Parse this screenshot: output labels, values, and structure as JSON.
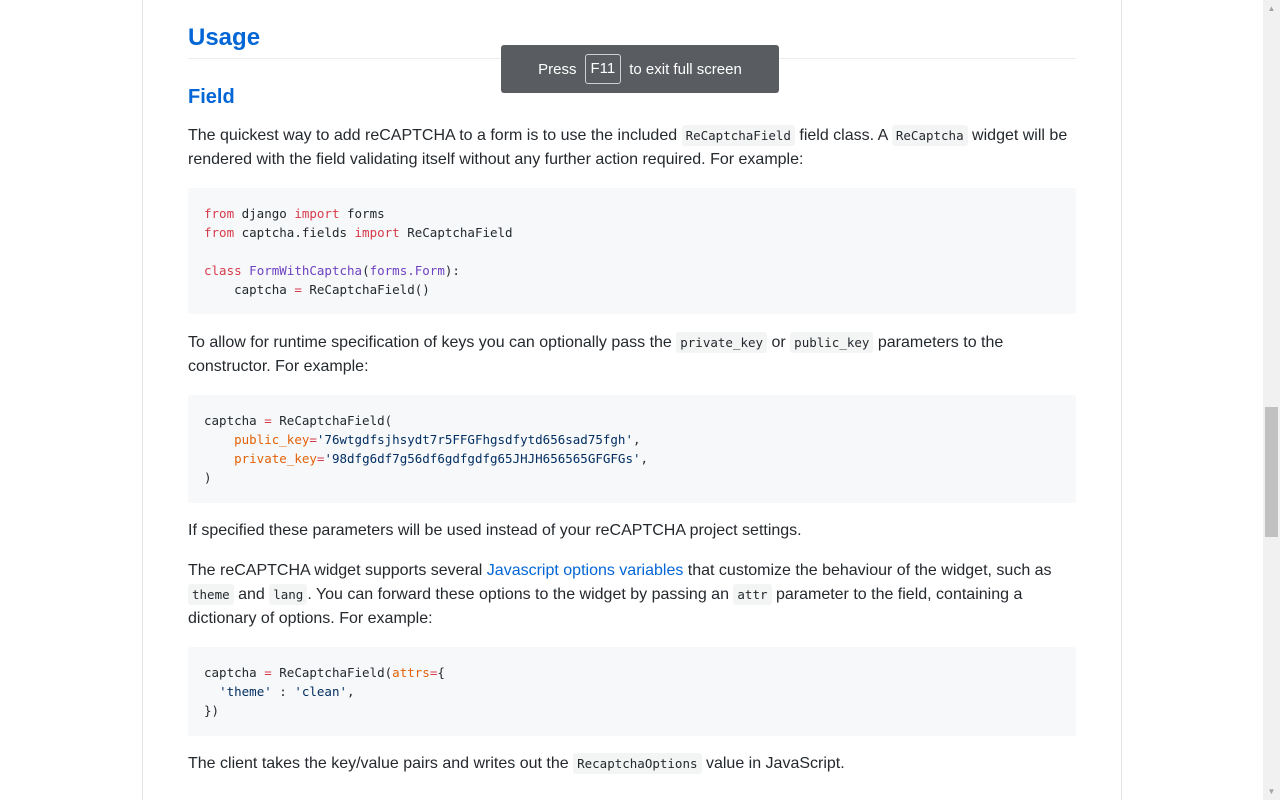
{
  "headings": {
    "usage": "Usage",
    "field": "Field"
  },
  "paragraphs": {
    "p1": {
      "t1": "The quickest way to add reCAPTCHA to a form is to use the included ",
      "c1": "ReCaptchaField",
      "t2": " field class. A ",
      "c2": "ReCaptcha",
      "t3": " widget will be rendered with the field validating itself without any further action required. For example:"
    },
    "p2": {
      "t1": "To allow for runtime specification of keys you can optionally pass the ",
      "c1": "private_key",
      "t2": " or ",
      "c2": "public_key",
      "t3": " parameters to the constructor. For example:"
    },
    "p3": "If specified these parameters will be used instead of your reCAPTCHA project settings.",
    "p4": {
      "t1": "The reCAPTCHA widget supports several ",
      "link": "Javascript options variables",
      "t2": " that customize the behaviour of the widget, such as ",
      "c1": "theme",
      "t3": " and ",
      "c2": "lang",
      "t4": ". You can forward these options to the widget by passing an ",
      "c3": "attr",
      "t5": " parameter to the field, containing a dictionary of options. For example:"
    },
    "p5": {
      "t1": "The client takes the key/value pairs and writes out the ",
      "c1": "RecaptchaOptions",
      "t2": " value in JavaScript."
    }
  },
  "code1": {
    "from": "from",
    "import": "import",
    "django": " django ",
    "forms": " forms",
    "captcha_fields": " captcha.fields ",
    "recaptchafield": " ReCaptchaField",
    "class": "class",
    "formname": "FormWithCaptcha",
    "base": "forms.Form",
    "line4_rest": "    captcha ",
    "eq": "=",
    "call": " ReCaptchaField()"
  },
  "code2": {
    "l1a": "captcha ",
    "eq": "=",
    "l1b": " ReCaptchaField(",
    "pub_name": "public_key",
    "pub_val": "'76wtgdfsjhsydt7r5FFGFhgsdfytd656sad75fgh'",
    "priv_name": "private_key",
    "priv_val": "'98dfg6df7g56df6gdfgdfg65JHJH656565GFGFGs'",
    "close": ")"
  },
  "code3": {
    "l1a": "captcha ",
    "eq": "=",
    "l1b": " ReCaptchaField(",
    "attrs": "attrs",
    "l1c": "{",
    "key": "'theme'",
    "sep": " : ",
    "val": "'clean'",
    "close": "})"
  },
  "toast": {
    "press": "Press",
    "key": "F11",
    "rest": "to exit full screen"
  },
  "scrollbar": {
    "up": "▲",
    "down": "▼"
  }
}
